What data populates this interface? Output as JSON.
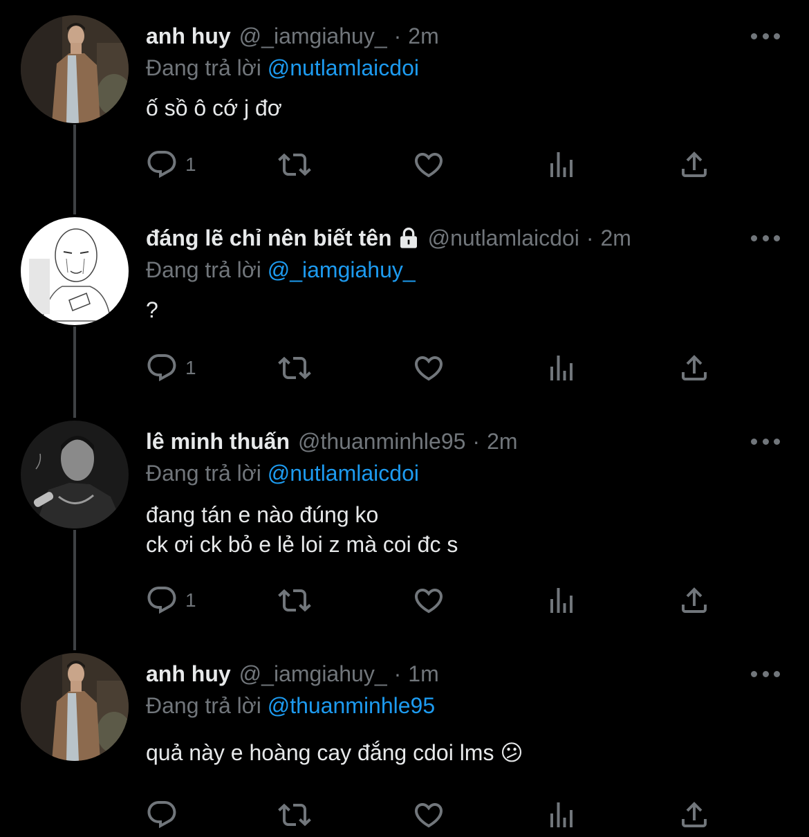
{
  "reply_prefix": "Đang trả lời",
  "tweets": [
    {
      "name": "anh huy",
      "handle": "@_iamgiahuy_",
      "separator": "·",
      "time": "2m",
      "reply_to": "@nutlamlaicdoi",
      "text": "ố sồ ô cớ j đơ",
      "reply_count": "1",
      "locked": false
    },
    {
      "name": "đáng lẽ chỉ nên biết tên",
      "handle": "@nutlamlaicdoi",
      "separator": "·",
      "time": "2m",
      "reply_to": "@_iamgiahuy_",
      "text": "?",
      "reply_count": "1",
      "locked": true
    },
    {
      "name": "lê minh thuấn",
      "handle": "@thuanminhle95",
      "separator": "·",
      "time": "2m",
      "reply_to": "@nutlamlaicdoi",
      "text_line1": "đang tán e nào đúng ko",
      "text_line2": "ck ơi ck bỏ e lẻ loi z mà coi đc s",
      "reply_count": "1",
      "locked": false
    },
    {
      "name": "anh huy",
      "handle": "@_iamgiahuy_",
      "separator": "·",
      "time": "1m",
      "reply_to": "@thuanminhle95",
      "text": "quả này e hoàng cay đắng cdoi lms 😕",
      "reply_count": "",
      "locked": false
    }
  ],
  "colors": {
    "background": "#000000",
    "primary_text": "#e7e9ea",
    "secondary_text": "#71767b",
    "link": "#1d9bf0",
    "thread_line": "#3e4144"
  },
  "icons": [
    "reply-icon",
    "retweet-icon",
    "like-icon",
    "views-icon",
    "share-icon",
    "more-icon",
    "lock-icon"
  ]
}
